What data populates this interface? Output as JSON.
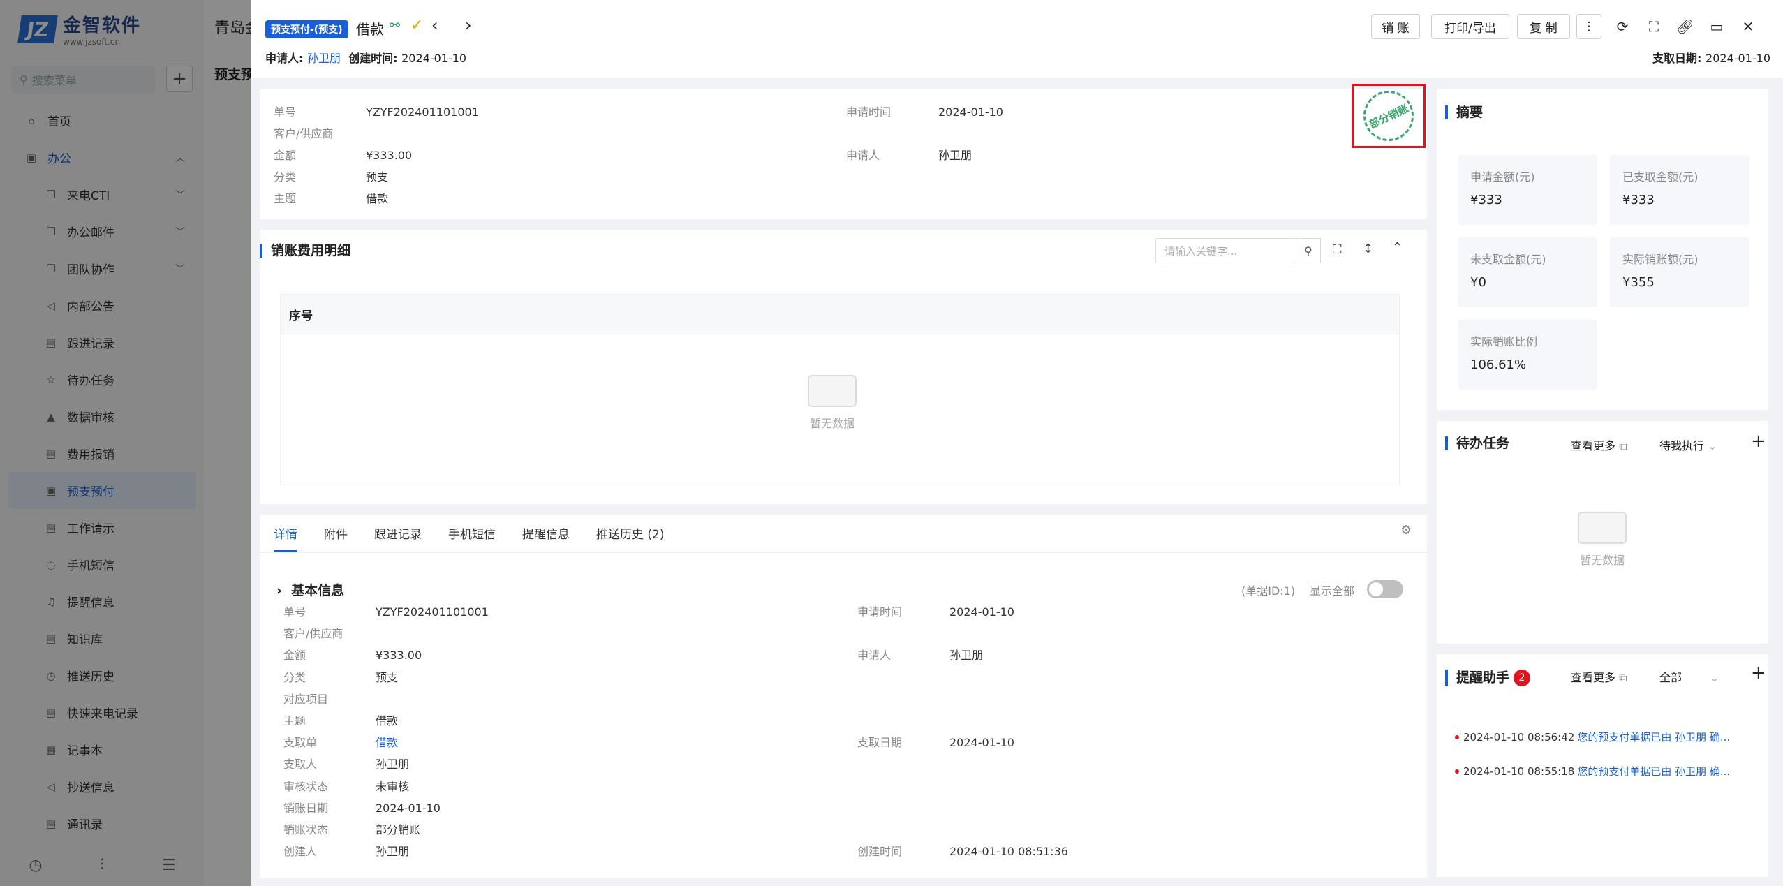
{
  "app": {
    "logo_mark": "JZ",
    "logo_name": "金智软件",
    "logo_url": "www.jzsoft.cn",
    "search_placeholder": "搜索菜单",
    "bg_title": "青岛金",
    "bg_tab": "预支预"
  },
  "sidebar": {
    "items": [
      {
        "label": "首页",
        "level": 1
      },
      {
        "label": "办公",
        "level": 1,
        "open": true
      },
      {
        "label": "来电CTI",
        "level": 2,
        "chev": true
      },
      {
        "label": "办公邮件",
        "level": 2,
        "chev": true
      },
      {
        "label": "团队协作",
        "level": 2,
        "chev": true
      },
      {
        "label": "内部公告",
        "level": 2
      },
      {
        "label": "跟进记录",
        "level": 2
      },
      {
        "label": "待办任务",
        "level": 2
      },
      {
        "label": "数据审核",
        "level": 2
      },
      {
        "label": "费用报销",
        "level": 2
      },
      {
        "label": "预支预付",
        "level": 2,
        "active": true
      },
      {
        "label": "工作请示",
        "level": 2
      },
      {
        "label": "手机短信",
        "level": 2
      },
      {
        "label": "提醒信息",
        "level": 2
      },
      {
        "label": "知识库",
        "level": 2
      },
      {
        "label": "推送历史",
        "level": 2
      },
      {
        "label": "快速来电记录",
        "level": 2
      },
      {
        "label": "记事本",
        "level": 2
      },
      {
        "label": "抄送信息",
        "level": 2
      },
      {
        "label": "通讯录",
        "level": 2
      }
    ]
  },
  "header": {
    "type_tag": "预支预付-(预支)",
    "title": "借款",
    "applicant_label": "申请人:",
    "applicant": "孙卫朋",
    "created_label": "创建时间:",
    "created": "2024-01-10",
    "pay_date_label": "支取日期:",
    "pay_date": "2024-01-10",
    "btn_writeoff": "销 账",
    "btn_print": "打印/导出",
    "btn_copy": "复 制"
  },
  "summary_fields": [
    {
      "k": "单号",
      "v": "YZYF202401101001"
    },
    {
      "k": "客户/供应商",
      "v": ""
    },
    {
      "k": "金额",
      "v": "¥333.00"
    },
    {
      "k": "分类",
      "v": "预支"
    },
    {
      "k": "主题",
      "v": "借款"
    },
    {
      "k": "申请时间",
      "v": "2024-01-10"
    },
    {
      "k": "申请人",
      "v": "孙卫朋"
    }
  ],
  "stamp_text": "部分销账",
  "detail_table": {
    "title": "销账费用明细",
    "search_placeholder": "请输入关键字...",
    "col_header": "序号",
    "empty_text": "暂无数据"
  },
  "tabs": [
    "详情",
    "附件",
    "跟进记录",
    "手机短信",
    "提醒信息",
    "推送历史 (2)"
  ],
  "basic_info": {
    "title": "基本信息",
    "doc_id": "(单据ID:1)",
    "show_all": "显示全部",
    "left": [
      {
        "k": "单号",
        "v": "YZYF202401101001"
      },
      {
        "k": "客户/供应商",
        "v": ""
      },
      {
        "k": "金额",
        "v": "¥333.00"
      },
      {
        "k": "分类",
        "v": "预支"
      },
      {
        "k": "对应项目",
        "v": ""
      },
      {
        "k": "主题",
        "v": "借款"
      },
      {
        "k": "支取单",
        "v": "借款"
      },
      {
        "k": "支取人",
        "v": "孙卫朋"
      },
      {
        "k": "审核状态",
        "v": "未审核"
      },
      {
        "k": "销账日期",
        "v": "2024-01-10"
      },
      {
        "k": "销账状态",
        "v": "部分销账"
      },
      {
        "k": "创建人",
        "v": "孙卫朋"
      }
    ],
    "right": [
      {
        "k": "申请时间",
        "v": "2024-01-10",
        "row": 0
      },
      {
        "k": "申请人",
        "v": "孙卫朋",
        "row": 2
      },
      {
        "k": "支取日期",
        "v": "2024-01-10",
        "row": 6
      },
      {
        "k": "创建时间",
        "v": "2024-01-10 08:51:36",
        "row": 11
      }
    ]
  },
  "digest": {
    "title": "摘要",
    "cards": [
      {
        "k": "申请金额(元)",
        "v": "¥333"
      },
      {
        "k": "已支取金额(元)",
        "v": "¥333"
      },
      {
        "k": "未支取金额(元)",
        "v": "¥0"
      },
      {
        "k": "实际销账额(元)",
        "v": "¥355"
      },
      {
        "k": "实际销账比例",
        "v": "106.61%"
      }
    ]
  },
  "todo": {
    "title": "待办任务",
    "more": "查看更多",
    "filter": "待我执行",
    "empty_text": "暂无数据"
  },
  "reminder": {
    "title": "提醒助手",
    "badge": "2",
    "more": "查看更多",
    "filter": "全部",
    "items": [
      {
        "time": "2024-01-10 08:56:42",
        "text": "您的预支付单据已由 孙卫朋 确..."
      },
      {
        "time": "2024-01-10 08:55:18",
        "text": "您的预支付单据已由 孙卫朋 确..."
      }
    ]
  }
}
